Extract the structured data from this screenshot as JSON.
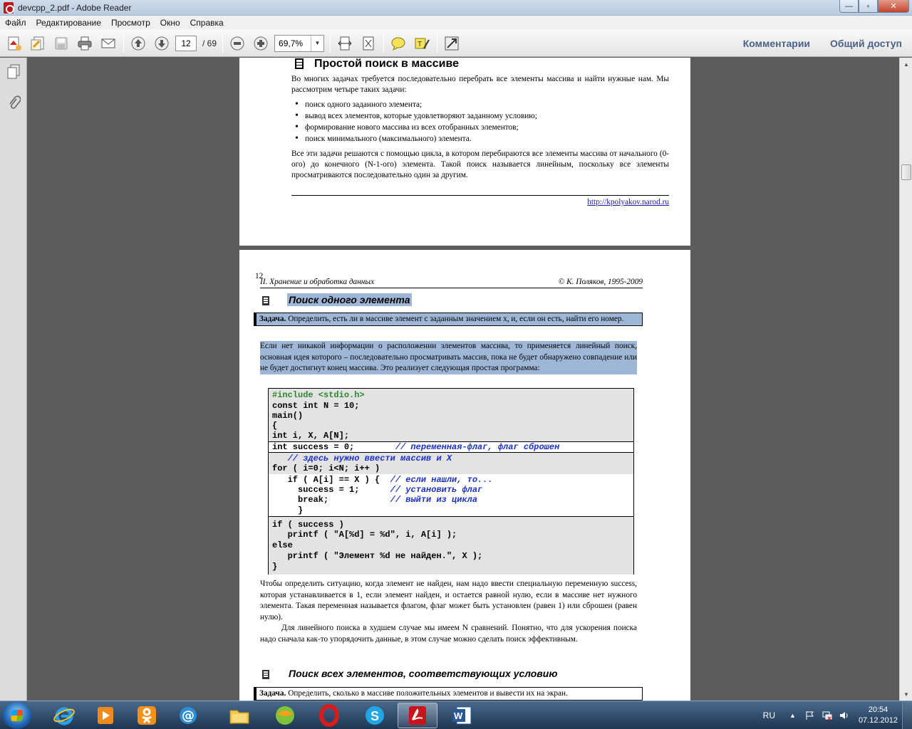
{
  "window": {
    "title": "devcpp_2.pdf - Adobe Reader",
    "min": "—",
    "max": "▫",
    "close": "✕"
  },
  "menu": [
    "Файл",
    "Редактирование",
    "Просмотр",
    "Окно",
    "Справка"
  ],
  "toolbar": {
    "page_current": "12",
    "page_total": "/ 69",
    "zoom": "69,7%",
    "comments_label": "Комментарии",
    "share_label": "Общий доступ"
  },
  "page1": {
    "title": "Простой поиск в массиве",
    "intro": "Во многих задачах требуется последовательно перебрать все элементы массива и найти нужные нам. Мы рассмотрим четыре таких задачи:",
    "list": [
      "поиск одного заданного элемента;",
      "вывод всех элементов, которые удовлетворяют заданному условию;",
      "формирование нового массива из всех отобранных элементов;",
      "поиск минимального (максимального) элемента."
    ],
    "para": "Все эти задачи решаются с помощью цикла, в котором перебираются все элементы массива от начального (0-ого) до конечного (N-1-ого) элемента. Такой поиск называется линейным, поскольку все элементы просматриваются последовательно один за другим.",
    "url": "http://kpolyakov.narod.ru"
  },
  "page2": {
    "page_number": "12",
    "header_left": "II. Хранение и обработка данных",
    "header_right": "© К. Поляков, 1995-2009",
    "section1_title": "Поиск одного элемента",
    "task1_label": "Задача.",
    "task1_text": " Определить, есть ли в массиве элемент с заданным  значением x, и, если он есть, найти его номер.",
    "para1": "Если нет никакой информации о расположении элементов массива, то применяется линейный поиск, основная идея которого – последовательно просматривать массив, пока не будет обнаружено совпадение или не будет достигнут конец массива. Это реализует следующая простая программа:",
    "code": [
      {
        "text": "#include <stdio.h>",
        "comment": ""
      },
      {
        "text": "const int N = 10;",
        "comment": ""
      },
      {
        "text": "main()",
        "comment": ""
      },
      {
        "text": "{",
        "comment": ""
      },
      {
        "text": "int i, X, A[N];",
        "comment": ""
      },
      {
        "text": "int success = 0;        ",
        "comment": "// переменная-флаг, флаг сброшен"
      },
      {
        "text": "   ",
        "comment": "// здесь нужно ввести массив и X"
      },
      {
        "text": "for ( i=0; i<N; i++ )",
        "comment": ""
      },
      {
        "text": "   if ( A[i] == X ) {  ",
        "comment": "// если нашли, то..."
      },
      {
        "text": "     success = 1;      ",
        "comment": "// установить флаг"
      },
      {
        "text": "     break;            ",
        "comment": "// выйти из цикла"
      },
      {
        "text": "     }",
        "comment": ""
      },
      {
        "text": "if ( success )",
        "comment": ""
      },
      {
        "text": "   printf ( \"A[%d] = %d\", i, A[i] );",
        "comment": ""
      },
      {
        "text": "else",
        "comment": ""
      },
      {
        "text": "   printf ( \"Элемент %d не найден.\", X );",
        "comment": ""
      },
      {
        "text": "}",
        "comment": ""
      }
    ],
    "para2": "Чтобы определить ситуацию, когда элемент не найден, нам надо ввести специальную переменную success, которая устанавливается в 1, если элемент найден, и остается равной нулю, если в массиве нет нужного элемента. Такая переменная называется флагом, флаг может быть установлен (равен 1) или сброшен (равен нулю).",
    "para3": "Для линейного поиска в худшем случае мы имеем N сравнений. Понятно, что для ускорения поиска надо сначала как-то упорядочить данные, в этом случае можно сделать поиск эффективным.",
    "section2_title": "Поиск всех элементов, соответствующих условию",
    "task2_label": "Задача.",
    "task2_text": " Определить, сколько в массиве положительных элементов и вывести их на экран."
  },
  "taskbar": {
    "apps": [
      "internet-explorer",
      "media-player",
      "odnoklassniki",
      "mail-agent",
      "file-explorer",
      "chrome-like",
      "opera",
      "skype",
      "adobe-reader",
      "word"
    ],
    "lang": "RU",
    "time": "20:54",
    "date": "07.12.2012"
  }
}
